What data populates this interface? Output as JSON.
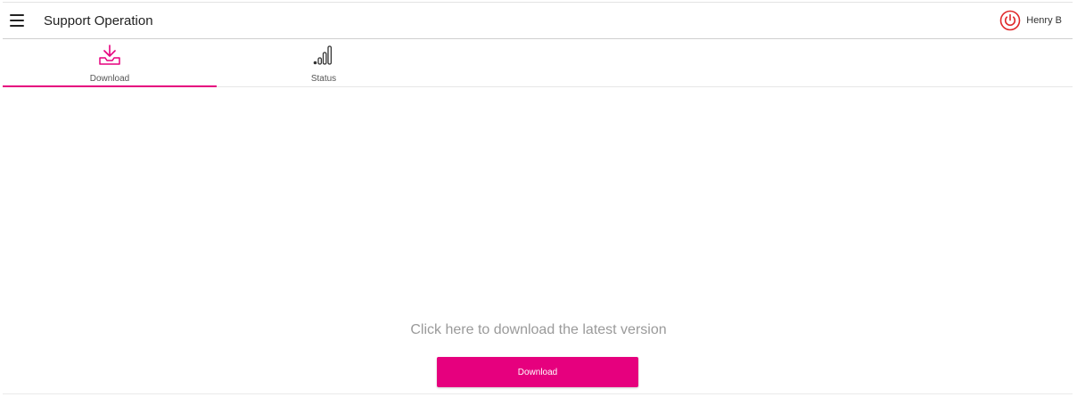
{
  "header": {
    "title": "Support Operation",
    "user_name": "Henry B",
    "menu_icon": "hamburger-menu-icon",
    "power_icon": "power-icon",
    "power_color": "#e0282a"
  },
  "tabs": [
    {
      "label": "Download",
      "icon": "download-tray-icon",
      "active": true
    },
    {
      "label": "Status",
      "icon": "signal-bars-icon",
      "active": false
    }
  ],
  "main": {
    "prompt": "Click here to download the latest version",
    "download_button_label": "Download"
  },
  "colors": {
    "accent": "#e6007e",
    "prompt_text": "#9a9a9a"
  }
}
